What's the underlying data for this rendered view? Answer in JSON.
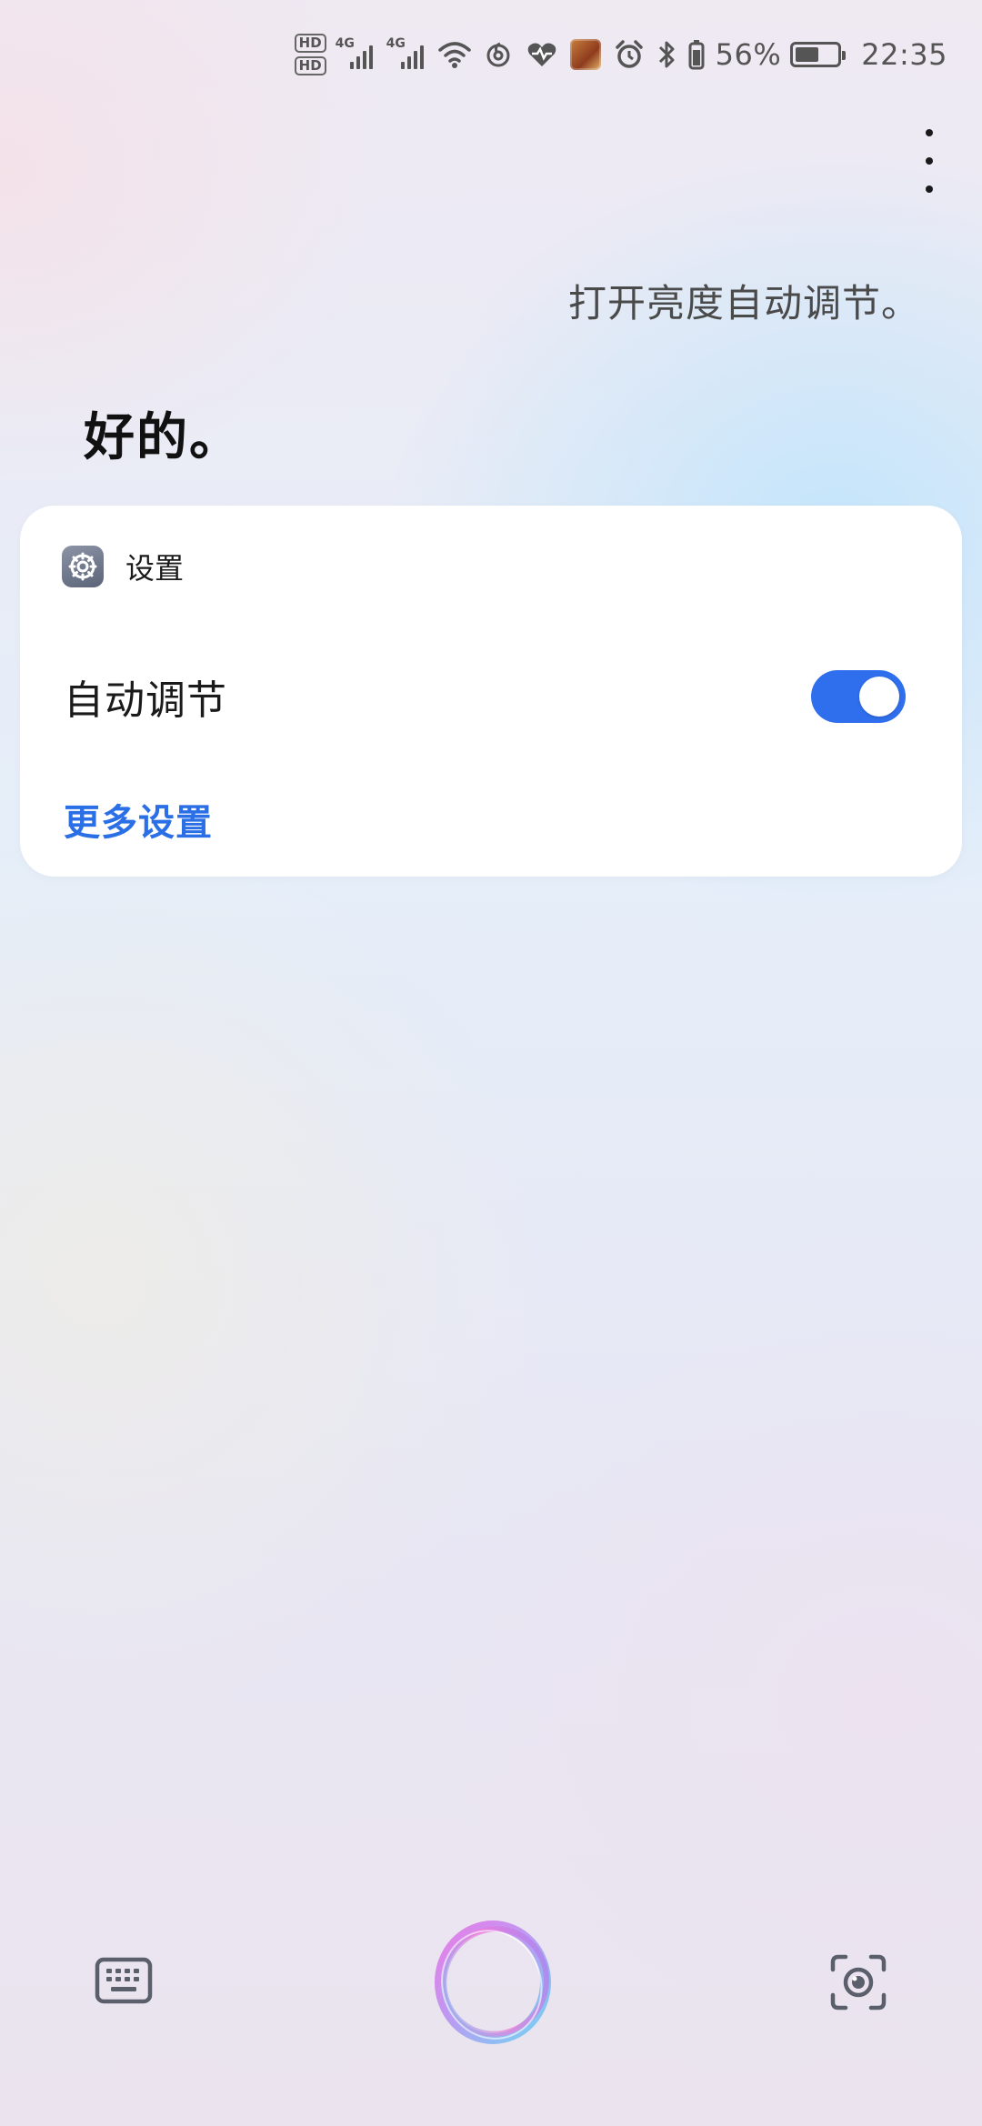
{
  "status_bar": {
    "sim1_label": "HD",
    "sim2_label": "HD",
    "sim1_network": "4G",
    "sim2_network": "4G",
    "battery_percent": "56%",
    "battery_level": 0.56,
    "time": "22:35",
    "icons": [
      "hd-sim1-icon",
      "hd-sim2-icon",
      "signal-sim1-icon",
      "signal-sim2-icon",
      "wifi-icon",
      "netease-music-icon",
      "health-heart-icon",
      "game-app-icon",
      "alarm-icon",
      "bluetooth-icon",
      "battery-icon"
    ]
  },
  "header": {
    "more_icon": "more-vertical-icon"
  },
  "conversation": {
    "user_query": "打开亮度自动调节。",
    "assistant_reply": "好的。"
  },
  "card": {
    "app_icon": "settings-gear-icon",
    "app_name": "设置",
    "setting_label": "自动调节",
    "toggle_on": true,
    "more_link": "更多设置"
  },
  "bottom_bar": {
    "left_icon": "keyboard-icon",
    "center_icon": "voice-orb-icon",
    "right_icon": "scan-camera-icon"
  },
  "colors": {
    "accent": "#2f6fed",
    "link": "#2a6fe6",
    "card_background": "#ffffff",
    "status_text": "#555555"
  }
}
